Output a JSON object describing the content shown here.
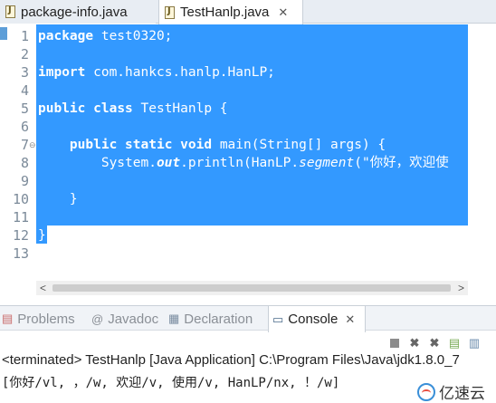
{
  "editor_tabs": [
    {
      "label": "package-info.java",
      "active": false
    },
    {
      "label": "TestHanlp.java",
      "active": true,
      "close": "✕"
    }
  ],
  "code": {
    "line_numbers": [
      "1",
      "2",
      "3",
      "4",
      "5",
      "6",
      "7",
      "8",
      "9",
      "10",
      "11",
      "12",
      "13"
    ],
    "selection_color": "#3399ff",
    "lines": {
      "l1_kw": "package",
      "l1_rest": " test0320;",
      "l3_kw": "import",
      "l3_rest": " com.hankcs.hanlp.HanLP;",
      "l5_kw1": "public",
      "l5_kw2": "class",
      "l5_rest": " TestHanlp {",
      "l7_kw1": "public",
      "l7_kw2": "static",
      "l7_kw3": "void",
      "l7_rest": " main(String[] args) {",
      "l8_a": "System.",
      "l8_out": "out",
      "l8_b": ".println(HanLP.",
      "l8_seg": "segment",
      "l8_c": "(\"你好，欢迎使",
      "l10": "}",
      "l12": "}"
    }
  },
  "panel_tabs": [
    {
      "label": "Problems",
      "icon": "problems-icon",
      "active": false
    },
    {
      "label": "Javadoc",
      "icon": "at-icon",
      "active": false
    },
    {
      "label": "Declaration",
      "icon": "declaration-icon",
      "active": false
    },
    {
      "label": "Console",
      "icon": "console-icon",
      "active": true,
      "close": "✕"
    }
  ],
  "console": {
    "terminated": "<terminated> TestHanlp [Java Application] C:\\Program Files\\Java\\jdk1.8.0_7",
    "output": "[你好/vl, ，/w, 欢迎/v, 使用/v, HanLP/nx, ！/w]"
  },
  "watermark": {
    "text": "亿速云"
  }
}
